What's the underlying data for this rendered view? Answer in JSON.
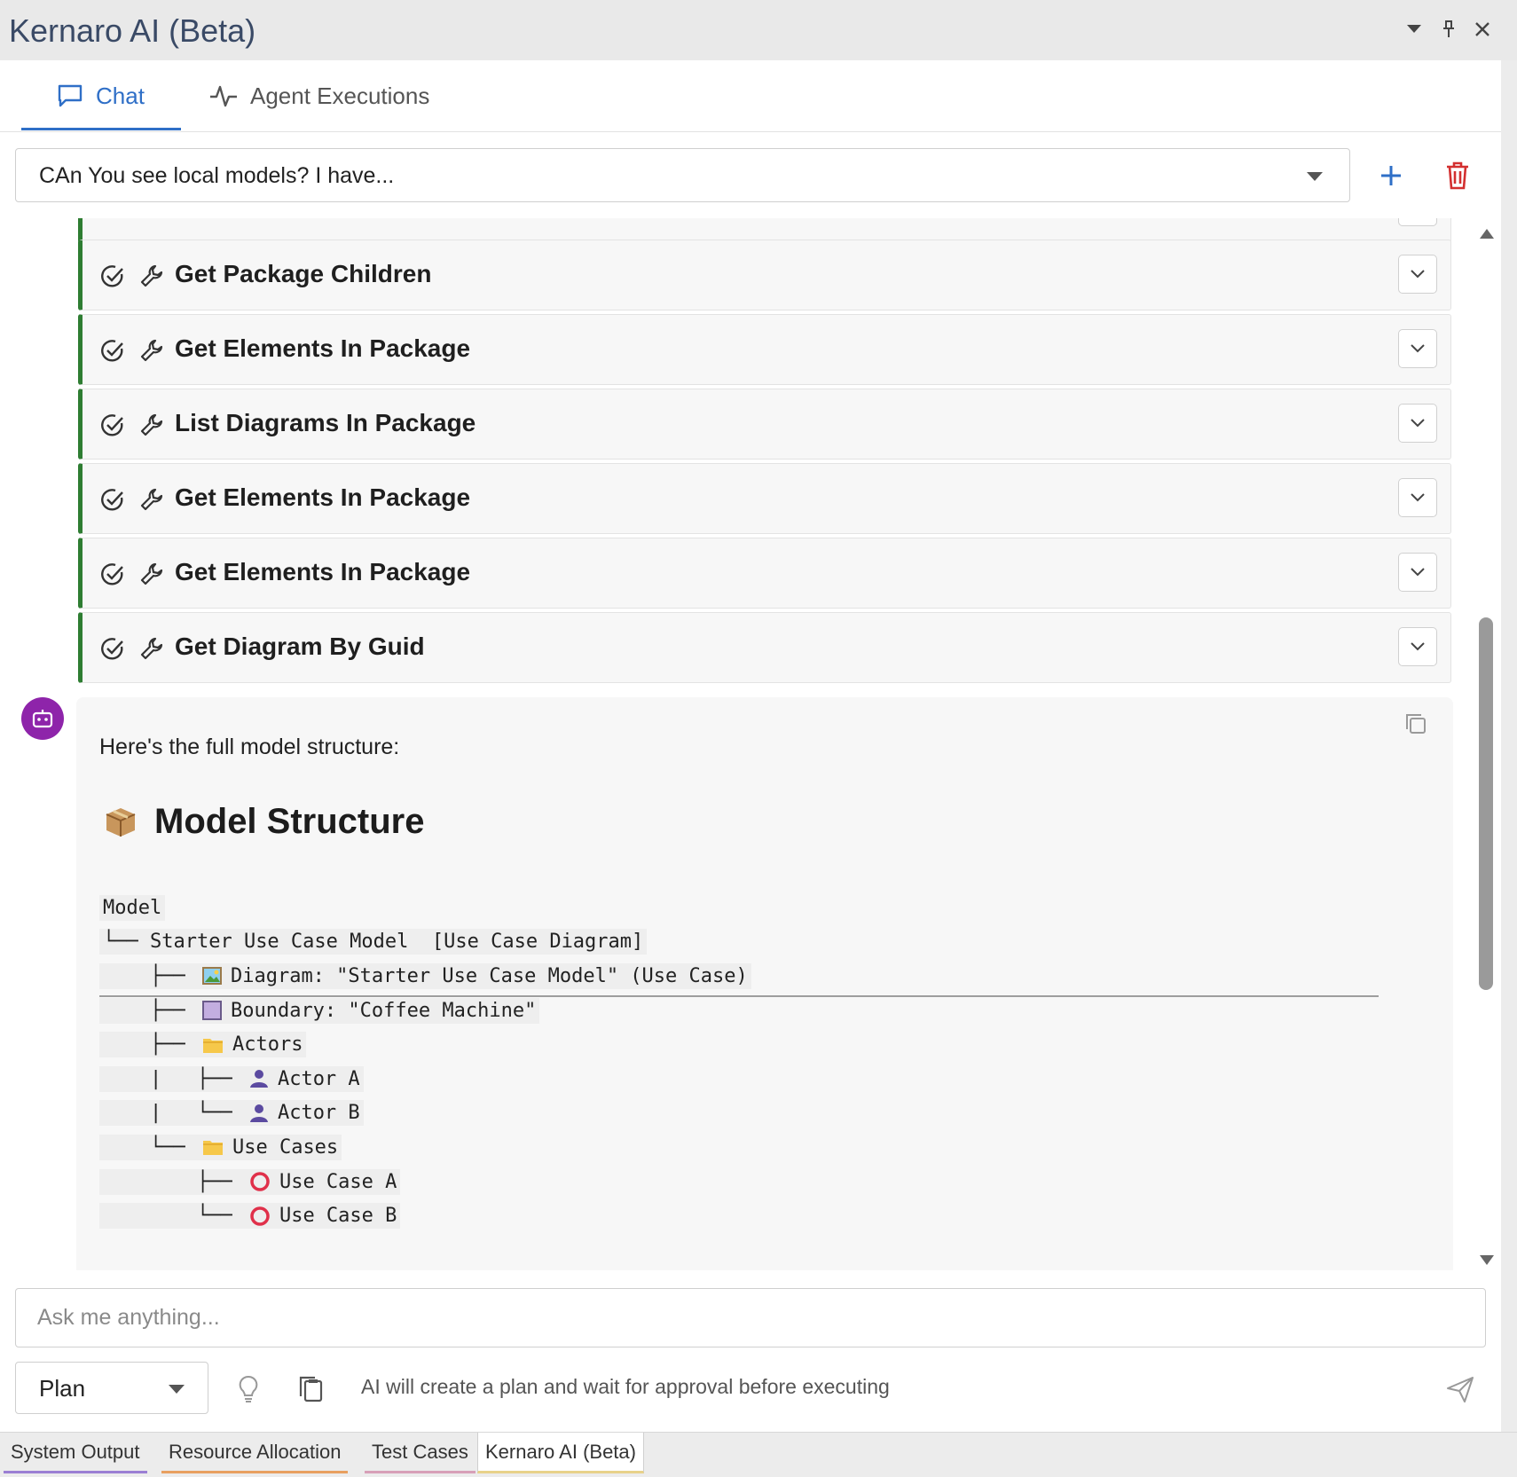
{
  "window": {
    "title": "Kernaro AI (Beta)"
  },
  "tabs": [
    {
      "label": "Chat",
      "icon": "chat-bubble-icon"
    },
    {
      "label": "Agent Executions",
      "icon": "activity-pulse-icon"
    }
  ],
  "conversation": {
    "selected": "CAn You see local models? I have..."
  },
  "tool_calls": [
    {
      "label": "Get Package Children"
    },
    {
      "label": "Get Elements In Package"
    },
    {
      "label": "List Diagrams In Package"
    },
    {
      "label": "Get Elements In Package"
    },
    {
      "label": "Get Elements In Package"
    },
    {
      "label": "Get Diagram By Guid"
    }
  ],
  "message": {
    "intro": "Here's the full model structure:",
    "heading": "Model Structure",
    "tree": [
      {
        "prefix": "",
        "icon": "",
        "text": "Model"
      },
      {
        "prefix": "└── ",
        "icon": "",
        "text": "Starter Use Case Model  [Use Case Diagram]"
      },
      {
        "prefix": "    ├── ",
        "icon": "picture-icon",
        "text": "Diagram: \"Starter Use Case Model\" (Use Case)"
      },
      {
        "prefix": "    ├── ",
        "icon": "purple-square-icon",
        "text": "Boundary: \"Coffee Machine\""
      },
      {
        "prefix": "    ├── ",
        "icon": "folder-icon",
        "text": "Actors"
      },
      {
        "prefix": "    |   ├── ",
        "icon": "person-icon",
        "text": "Actor A"
      },
      {
        "prefix": "    |   └── ",
        "icon": "person-icon",
        "text": "Actor B"
      },
      {
        "prefix": "    └── ",
        "icon": "folder-icon",
        "text": "Use Cases"
      },
      {
        "prefix": "        ├── ",
        "icon": "red-circle-icon",
        "text": "Use Case A"
      },
      {
        "prefix": "        └── ",
        "icon": "red-circle-icon",
        "text": "Use Case B"
      }
    ]
  },
  "input": {
    "placeholder": "Ask me anything..."
  },
  "mode": {
    "selected": "Plan",
    "hint": "AI will create a plan and wait for approval before executing"
  },
  "bottom_tabs": [
    {
      "label": "System Output",
      "color": "#9b7fd4"
    },
    {
      "label": "Resource Allocation",
      "color": "#e8a060"
    },
    {
      "label": "Test Cases",
      "color": "#d7a0b8"
    },
    {
      "label": "Kernaro AI (Beta)",
      "color": "#e8d28a"
    }
  ],
  "colors": {
    "accent": "#2f6fc7",
    "success_bar": "#2e7d32",
    "avatar": "#8e24aa",
    "delete": "#d32f2f"
  }
}
